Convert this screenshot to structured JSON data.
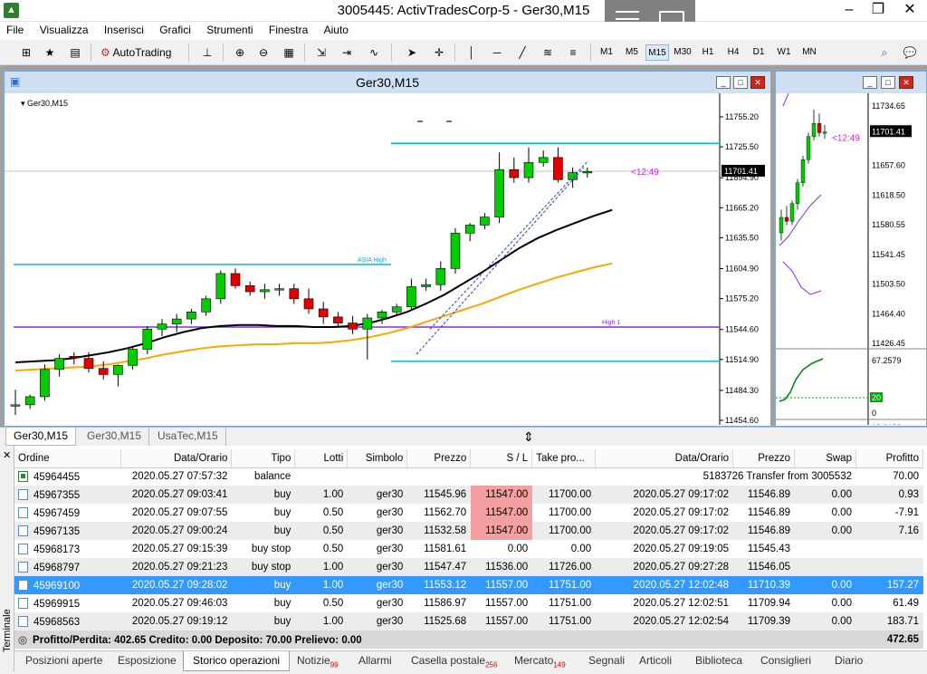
{
  "app": {
    "title": "3005445: ActivTradesCorp-5 - Ger30,M15"
  },
  "menu": [
    "File",
    "Visualizza",
    "Inserisci",
    "Grafici",
    "Strumenti",
    "Finestra",
    "Aiuto"
  ],
  "toolbar": {
    "autotrading": "AutoTrading",
    "timeframes": [
      "M1",
      "M5",
      "M15",
      "M30",
      "H1",
      "H4",
      "D1",
      "W1",
      "MN"
    ],
    "active_tf": "M15"
  },
  "chart_main": {
    "title": "Ger30,M15",
    "symbol_label": "Ger30,M15",
    "current_price": "11701.41",
    "countdown": "<12:49",
    "price_ticks": [
      "11755.20",
      "11725.50",
      "11694.90",
      "11665.20",
      "11635.50",
      "11604.90",
      "11575.20",
      "11544.60",
      "11514.90",
      "11484.30",
      "11454.60"
    ],
    "labels": {
      "asia_high": "ASIA High",
      "high1": "High 1"
    }
  },
  "chart_side": {
    "current_price": "11701.41",
    "countdown": "<12:49",
    "price_ticks": [
      "11734.65",
      "11657.60",
      "11618.50",
      "11580.55",
      "11541.45",
      "11503.50",
      "11464.40",
      "11426.45"
    ],
    "ind_ticks": [
      "67.2579",
      "20",
      "0",
      "19.0486"
    ]
  },
  "chart_tabs": [
    "Ger30,M15",
    "Ger30,M15",
    "UsaTec,M15"
  ],
  "terminal": {
    "side_label": "Terminale",
    "columns": [
      "Ordine",
      "Data/Orario",
      "Tipo",
      "Lotti",
      "Simbolo",
      "Prezzo",
      "S / L",
      "Take pro...",
      "Data/Orario",
      "Prezzo",
      "Swap",
      "Profitto"
    ],
    "rows": [
      {
        "kind": "balance",
        "order": "45964455",
        "open_time": "2020.05.27 07:57:32",
        "type": "balance",
        "comment": "5183726 Transfer from 3005532",
        "profit": "70.00"
      },
      {
        "order": "45967355",
        "open_time": "2020.05.27 09:03:41",
        "type": "buy",
        "lots": "1.00",
        "symbol": "ger30",
        "price": "11545.96",
        "sl": "11547.00",
        "tp": "11700.00",
        "close_time": "2020.05.27 09:17:02",
        "close_price": "11546.89",
        "swap": "0.00",
        "profit": "0.93",
        "sl_hit": true
      },
      {
        "order": "45967459",
        "open_time": "2020.05.27 09:07:55",
        "type": "buy",
        "lots": "0.50",
        "symbol": "ger30",
        "price": "11562.70",
        "sl": "11547.00",
        "tp": "11700.00",
        "close_time": "2020.05.27 09:17:02",
        "close_price": "11546.89",
        "swap": "0.00",
        "profit": "-7.91",
        "sl_hit": true
      },
      {
        "order": "45967135",
        "open_time": "2020.05.27 09:00:24",
        "type": "buy",
        "lots": "0.50",
        "symbol": "ger30",
        "price": "11532.58",
        "sl": "11547.00",
        "tp": "11700.00",
        "close_time": "2020.05.27 09:17:02",
        "close_price": "11546.89",
        "swap": "0.00",
        "profit": "7.16",
        "sl_hit": true
      },
      {
        "order": "45968173",
        "open_time": "2020.05.27 09:15:39",
        "type": "buy stop",
        "lots": "0.50",
        "symbol": "ger30",
        "price": "11581.61",
        "sl": "0.00",
        "tp": "0.00",
        "close_time": "2020.05.27 09:19:05",
        "close_price": "11545.43",
        "swap": "",
        "profit": ""
      },
      {
        "order": "45968797",
        "open_time": "2020.05.27 09:21:23",
        "type": "buy stop",
        "lots": "1.00",
        "symbol": "ger30",
        "price": "11547.47",
        "sl": "11536.00",
        "tp": "11726.00",
        "close_time": "2020.05.27 09:27:28",
        "close_price": "11546.05",
        "swap": "",
        "profit": ""
      },
      {
        "order": "45969100",
        "open_time": "2020.05.27 09:28:02",
        "type": "buy",
        "lots": "1.00",
        "symbol": "ger30",
        "price": "11553.12",
        "sl": "11557.00",
        "tp": "11751.00",
        "close_time": "2020.05.27 12:02:48",
        "close_price": "11710.39",
        "swap": "0.00",
        "profit": "157.27",
        "selected": true
      },
      {
        "order": "45969915",
        "open_time": "2020.05.27 09:46:03",
        "type": "buy",
        "lots": "0.50",
        "symbol": "ger30",
        "price": "11586.97",
        "sl": "11557.00",
        "tp": "11751.00",
        "close_time": "2020.05.27 12:02:51",
        "close_price": "11709.94",
        "swap": "0.00",
        "profit": "61.49"
      },
      {
        "order": "45968563",
        "open_time": "2020.05.27 09:19:12",
        "type": "buy",
        "lots": "1.00",
        "symbol": "ger30",
        "price": "11525.68",
        "sl": "11557.00",
        "tp": "11751.00",
        "close_time": "2020.05.27 12:02:54",
        "close_price": "11709.39",
        "swap": "0.00",
        "profit": "183.71"
      }
    ],
    "summary": {
      "text": "Profitto/Perdita: 402.65  Credito: 0.00  Deposito: 70.00  Prelievo: 0.00",
      "total": "472.65"
    },
    "tabs": [
      {
        "label": "Posizioni aperte"
      },
      {
        "label": "Esposizione"
      },
      {
        "label": "Storico operazioni",
        "active": true
      },
      {
        "label": "Notizie",
        "badge": "99"
      },
      {
        "label": "Allarmi"
      },
      {
        "label": "Casella postale",
        "badge": "256"
      },
      {
        "label": "Mercato",
        "badge": "149"
      },
      {
        "label": "Segnali"
      },
      {
        "label": "Articoli"
      },
      {
        "label": "Biblioteca"
      },
      {
        "label": "Consiglieri"
      },
      {
        "label": "Diario"
      }
    ]
  },
  "colors": {
    "bull": "#00cc00",
    "bear": "#e00000",
    "ma_fast": "#000000",
    "ma_slow": "#ffa500",
    "level_cyan": "#00bcd4",
    "level_purple": "#8a2be2",
    "select": "#3399ff",
    "countdown": "#e020e0"
  }
}
